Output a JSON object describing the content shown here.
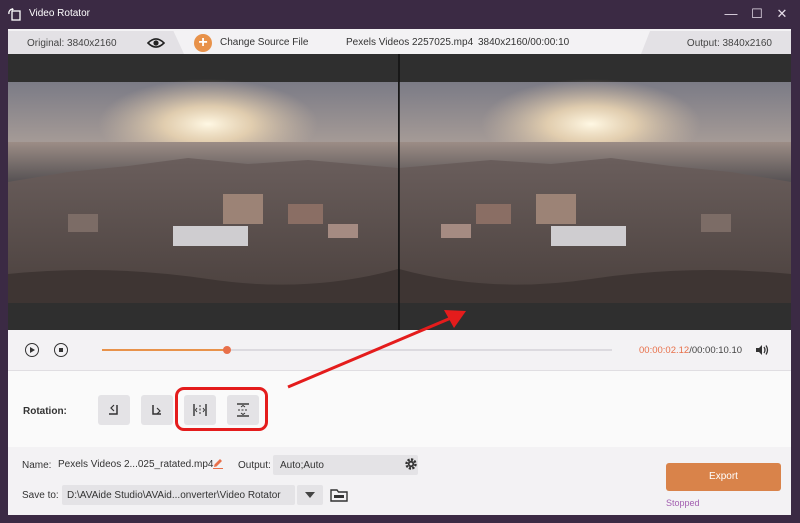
{
  "window": {
    "title": "Video Rotator",
    "controls": {
      "minimize": "—",
      "maximize": "☐",
      "close": "✕"
    }
  },
  "infobar": {
    "original_label": "Original: 3840x2160",
    "change_source_label": "Change Source File",
    "file_name": "Pexels Videos 2257025.mp4",
    "file_meta": "3840x2160/00:00:10",
    "output_label": "Output: 3840x2160"
  },
  "playback": {
    "current_time": "00:00:02.12",
    "total_time": "/00:00:10.10",
    "progress": 0.245
  },
  "rotation": {
    "label": "Rotation:",
    "buttons": [
      "rotate-left",
      "rotate-right",
      "flip-horizontal",
      "flip-vertical"
    ]
  },
  "output_settings": {
    "name_label": "Name:",
    "name_value": "Pexels Videos 2...025_ratated.mp4",
    "output_label": "Output:",
    "output_value": "Auto;Auto",
    "save_label": "Save to:",
    "save_path": "D:\\AVAide Studio\\AVAid...onverter\\Video Rotator",
    "export_label": "Export",
    "status": "Stopped"
  },
  "colors": {
    "accent": "#e8924a",
    "titlebar": "#3b2a44",
    "highlight": "#e41c1c",
    "status": "#a25fb0"
  }
}
